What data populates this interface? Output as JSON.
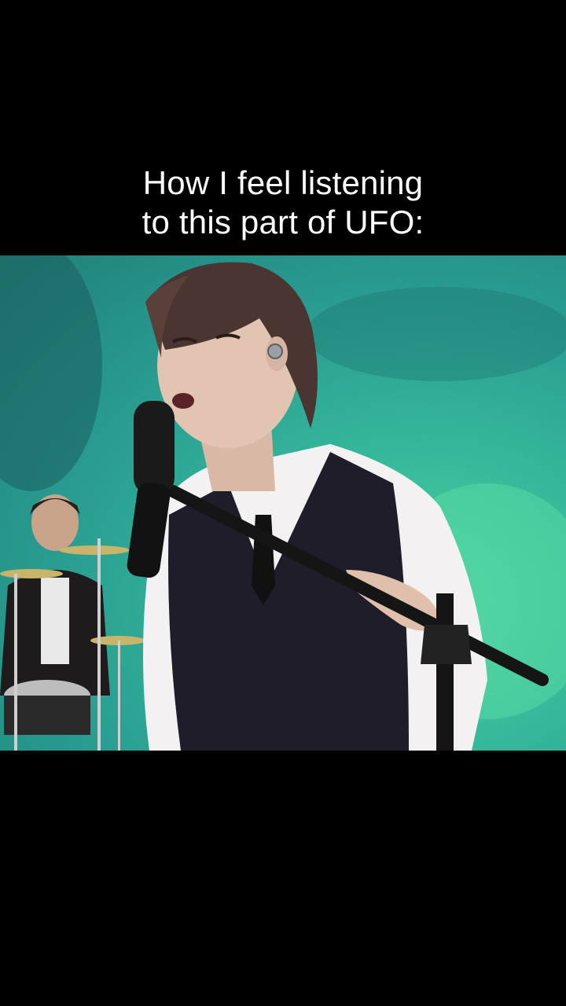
{
  "caption": {
    "line1": "How I feel listening",
    "line2": "to this part of UFO:"
  },
  "video": {
    "background_color": "#2fb09a",
    "description_icon": "video-frame"
  }
}
